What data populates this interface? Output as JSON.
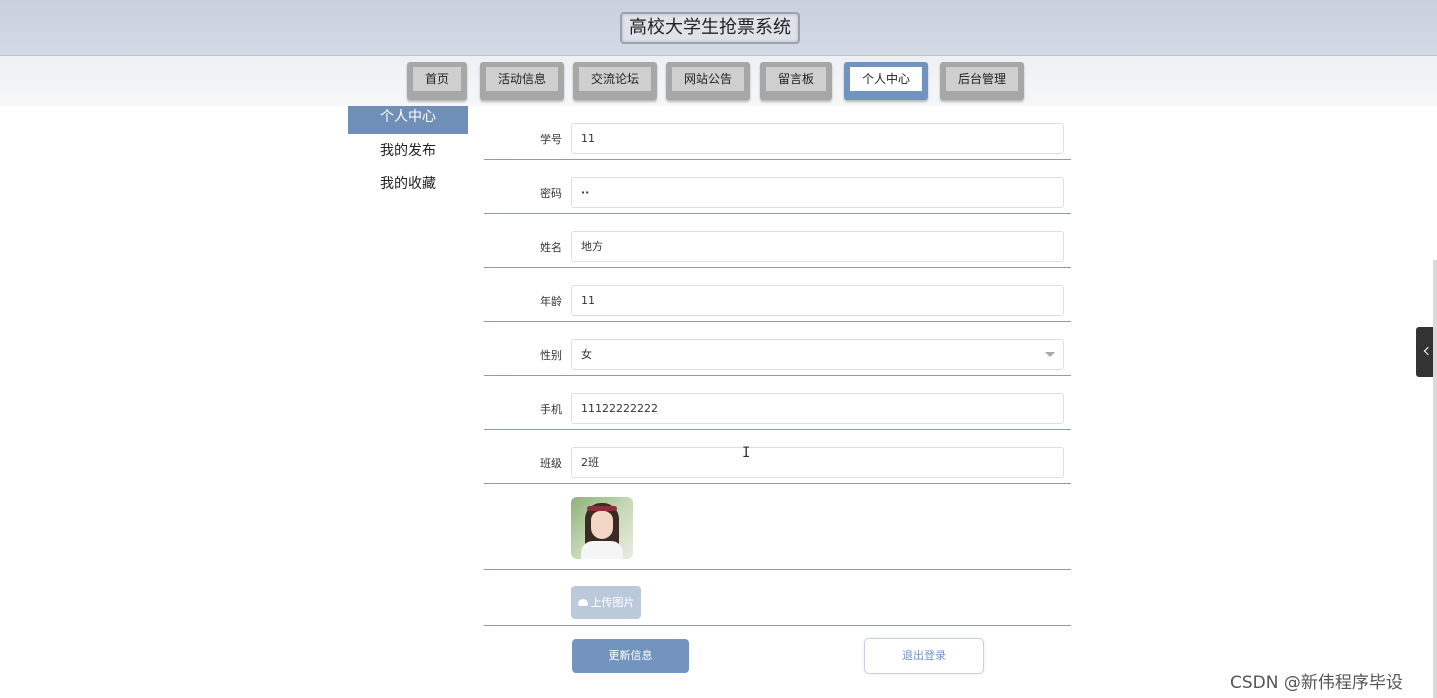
{
  "site": {
    "title": "高校大学生抢票系统"
  },
  "nav": {
    "items": [
      {
        "label": "首页",
        "active": false
      },
      {
        "label": "活动信息",
        "active": false
      },
      {
        "label": "交流论坛",
        "active": false
      },
      {
        "label": "网站公告",
        "active": false
      },
      {
        "label": "留言板",
        "active": false
      },
      {
        "label": "个人中心",
        "active": true
      },
      {
        "label": "后台管理",
        "active": false
      }
    ]
  },
  "sidebar": {
    "items": [
      {
        "label": "个人中心",
        "active": true
      },
      {
        "label": "我的发布",
        "active": false
      },
      {
        "label": "我的收藏",
        "active": false
      }
    ]
  },
  "form": {
    "fields": [
      {
        "label": "学号",
        "value": "11"
      },
      {
        "label": "密码",
        "value": "··"
      },
      {
        "label": "姓名",
        "value": "地方"
      },
      {
        "label": "年龄",
        "value": "11"
      },
      {
        "label": "性别",
        "value": "女"
      },
      {
        "label": "手机",
        "value": "11122222222"
      },
      {
        "label": "班级",
        "value": "2班"
      }
    ],
    "upload_label": "上传图片",
    "update_label": "更新信息",
    "logout_label": "退出登录"
  },
  "watermark": "CSDN @新伟程序毕设",
  "colors": {
    "accent": "#7494c0",
    "header": "#cfd6e1"
  }
}
